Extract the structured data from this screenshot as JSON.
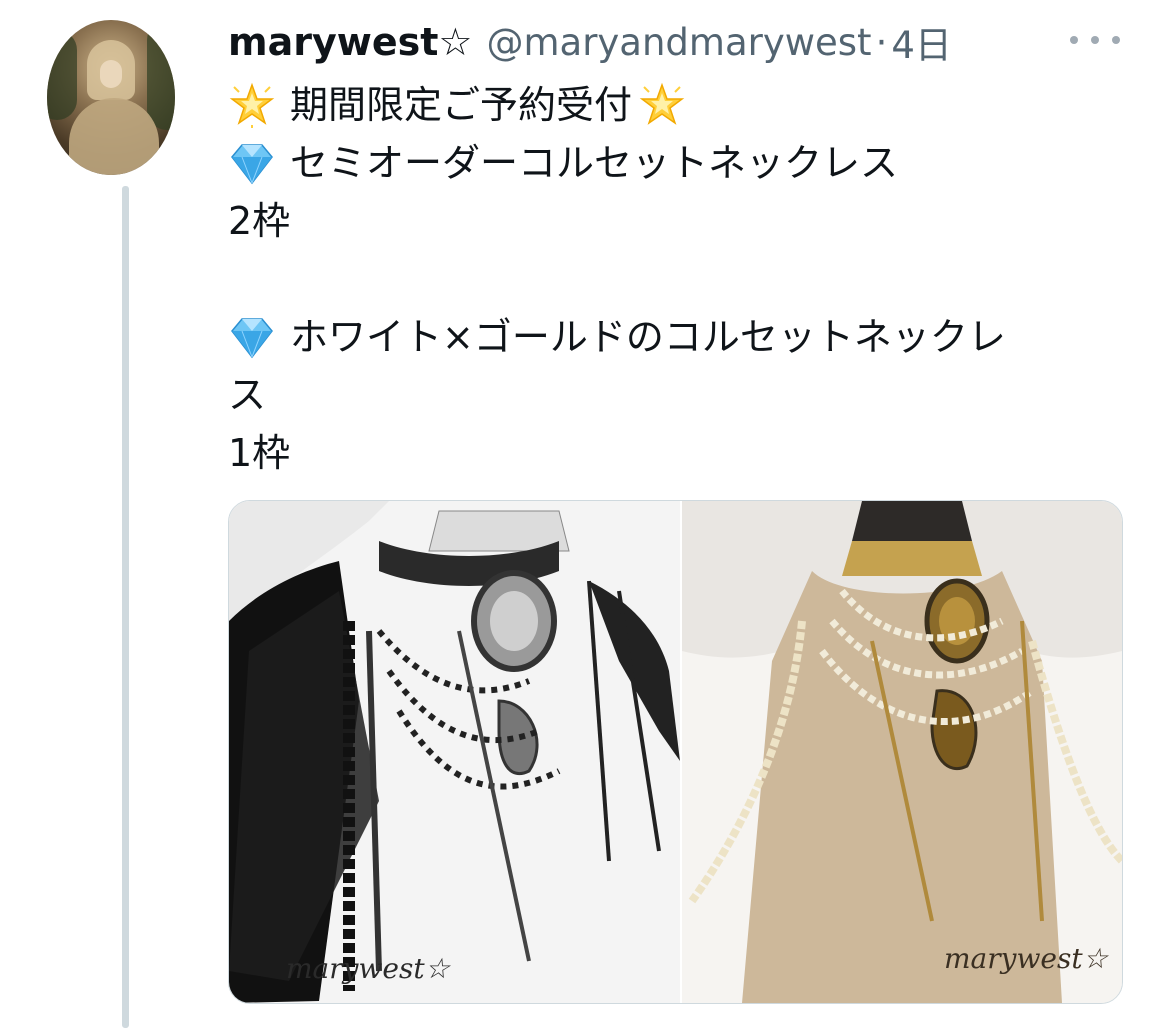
{
  "tweet": {
    "display_name": "marywest☆",
    "handle": "@maryandmarywest",
    "separator": "·",
    "time": "4日",
    "lines": [
      "期間限定ご予約受付",
      "セミオーダーコルセットネックレス",
      "2枠",
      "",
      "ホワイト×ゴールドのコルセットネックレ",
      "ス",
      "1枠"
    ],
    "line_icons": [
      "glowing-star-icon",
      "gem-icon",
      null,
      null,
      "gem-icon",
      null,
      null
    ]
  },
  "media": {
    "count": 2,
    "watermarks": [
      "marywest☆",
      "marywest☆"
    ],
    "photos": [
      "black-corset-necklace-photo",
      "white-gold-corset-necklace-photo"
    ]
  },
  "colors": {
    "text": "#0f1419",
    "secondary": "#536471",
    "thread_line": "#cfd9de",
    "border": "#cfd9de"
  }
}
